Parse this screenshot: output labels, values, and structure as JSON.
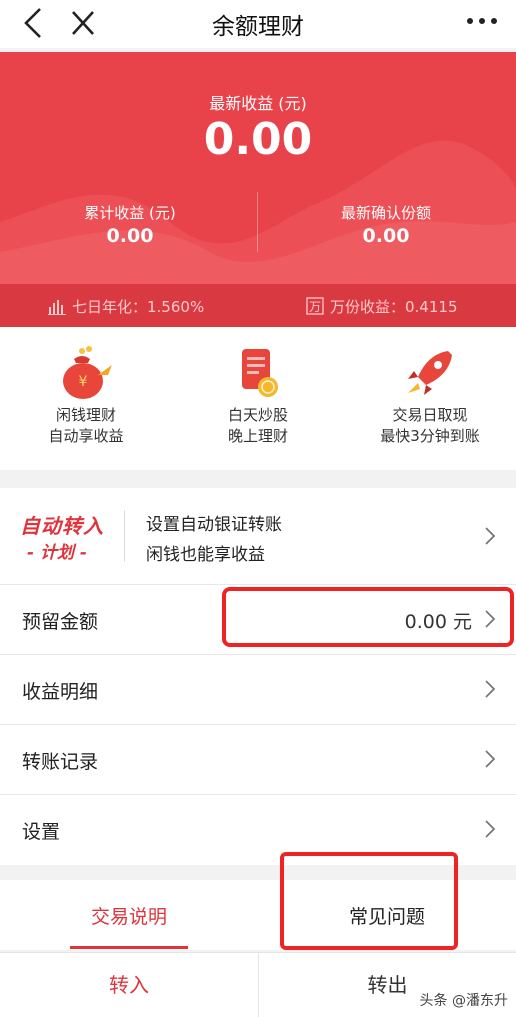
{
  "header": {
    "title": "余额理财"
  },
  "hero": {
    "latest_label": "最新收益 (元)",
    "latest_value": "0.00",
    "cumulative_label": "累计收益 (元)",
    "cumulative_value": "0.00",
    "confirmed_label": "最新确认份额",
    "confirmed_value": "0.00",
    "seven_day_label": "七日年化：1.560%",
    "per_10k_icon_char": "万",
    "per_10k_label": "万份收益：0.4115",
    "colors": {
      "background": "#e8434a",
      "strip": "#d93a41"
    }
  },
  "features": [
    {
      "icon": "money-bag-icon",
      "line1": "闲钱理财",
      "line2": "自动享收益"
    },
    {
      "icon": "phone-coin-icon",
      "line1": "白天炒股",
      "line2": "晚上理财"
    },
    {
      "icon": "rocket-icon",
      "line1": "交易日取现",
      "line2": "最快3分钟到账"
    }
  ],
  "auto_plan": {
    "logo_line1": "自动转入",
    "logo_line2": "- 计划 -",
    "text1": "设置自动银证转账",
    "text2": "闲钱也能享收益"
  },
  "rows": {
    "reserve_label": "预留金额",
    "reserve_value": "0.00 元",
    "details_label": "收益明细",
    "records_label": "转账记录",
    "settings_label": "设置"
  },
  "tabs": {
    "tab1": "交易说明",
    "tab2": "常见问题"
  },
  "bottom": {
    "transfer_in": "转入",
    "transfer_out": "转出"
  },
  "watermark": "头条 @潘东升",
  "colors": {
    "accent": "#e0343d",
    "highlight": "#ef2323"
  }
}
